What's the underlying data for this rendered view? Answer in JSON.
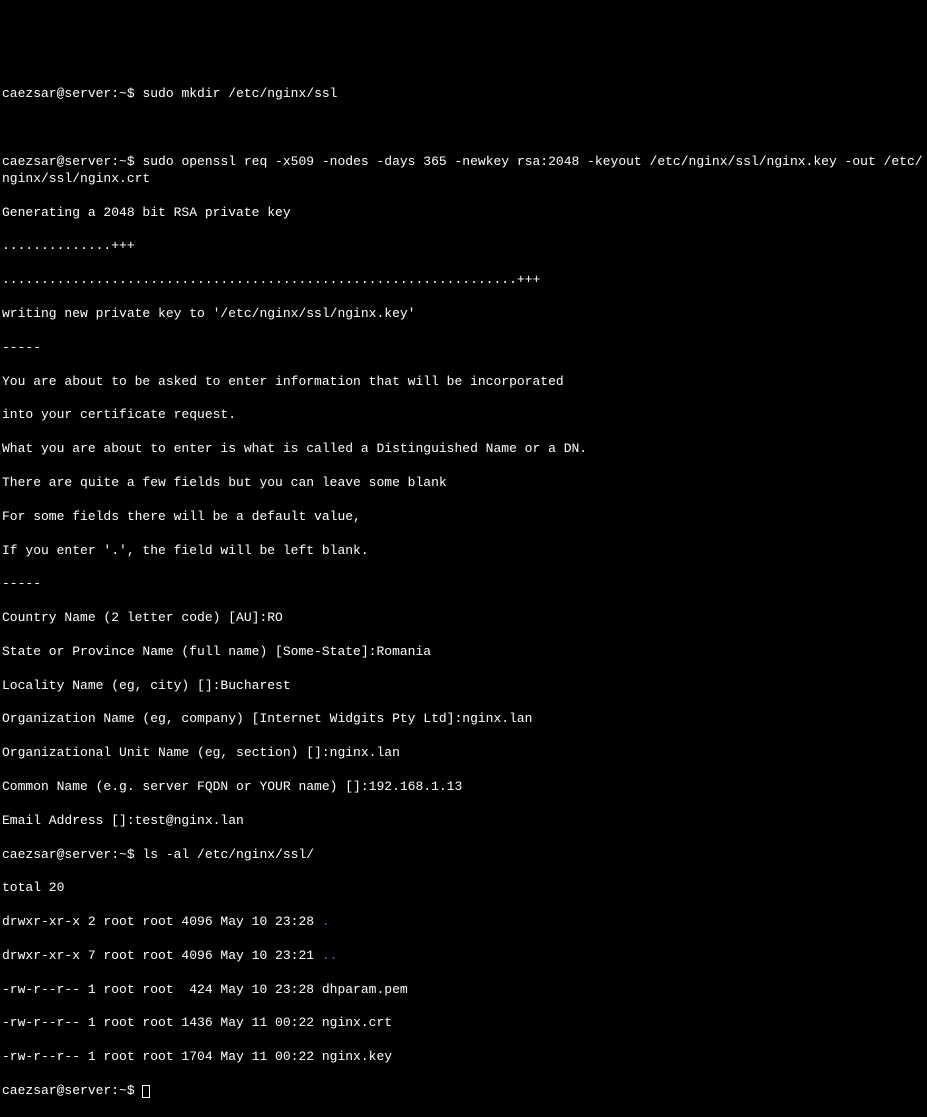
{
  "prompt": "caezsar@server:~$ ",
  "commands": {
    "mkdir": "sudo mkdir /etc/nginx/ssl",
    "openssl": "sudo openssl req -x509 -nodes -days 365 -newkey rsa:2048 -keyout /etc/nginx/ssl/nginx.key -out /etc/nginx/ssl/nginx.crt",
    "ls": "ls -al /etc/nginx/ssl/"
  },
  "output": {
    "generating": "Generating a 2048 bit RSA private key",
    "dots1": "..............+++",
    "dots2": "..................................................................+++",
    "writing": "writing new private key to '/etc/nginx/ssl/nginx.key'",
    "dashes": "-----",
    "info1": "You are about to be asked to enter information that will be incorporated",
    "info2": "into your certificate request.",
    "info3": "What you are about to enter is what is called a Distinguished Name or a DN.",
    "info4": "There are quite a few fields but you can leave some blank",
    "info5": "For some fields there will be a default value,",
    "info6": "If you enter '.', the field will be left blank.",
    "country": "Country Name (2 letter code) [AU]:RO",
    "state": "State or Province Name (full name) [Some-State]:Romania",
    "locality": "Locality Name (eg, city) []:Bucharest",
    "org": "Organization Name (eg, company) [Internet Widgits Pty Ltd]:nginx.lan",
    "orgunit": "Organizational Unit Name (eg, section) []:nginx.lan",
    "common": "Common Name (e.g. server FQDN or YOUR name) []:192.168.1.13",
    "email": "Email Address []:test@nginx.lan"
  },
  "ls_output": {
    "total": "total 20",
    "line1_pre": "drwxr-xr-x 2 root root 4096 May 10 23:28 ",
    "line1_dot": ".",
    "line2_pre": "drwxr-xr-x 7 root root 4096 May 10 23:21 ",
    "line2_dots": "..",
    "line3": "-rw-r--r-- 1 root root  424 May 10 23:28 dhparam.pem",
    "line4": "-rw-r--r-- 1 root root 1436 May 11 00:22 nginx.crt",
    "line5": "-rw-r--r-- 1 root root 1704 May 11 00:22 nginx.key"
  }
}
